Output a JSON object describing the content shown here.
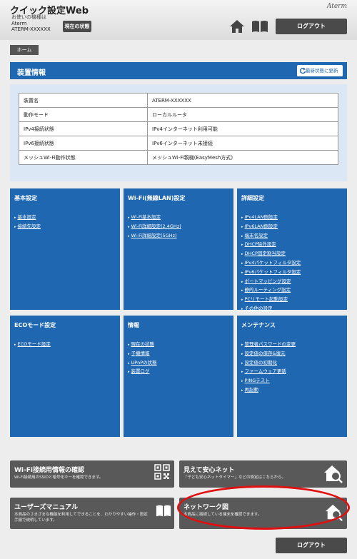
{
  "header": {
    "app_title": "クイック設定Web",
    "device_label": "お使いの機種は",
    "device_name": "Aterm",
    "device_id": "ATERM-XXXXXX",
    "status_button": "現在の状態",
    "brand": "Aterm",
    "logout": "ログアウト"
  },
  "breadcrumb": "ホーム",
  "device_info": {
    "title": "装置情報",
    "refresh": "最新状態に更新",
    "rows": [
      {
        "key": "装置名",
        "value": "ATERM-XXXXXX"
      },
      {
        "key": "動作モード",
        "value": "ローカルルータ"
      },
      {
        "key": "IPv4接続状態",
        "value": "IPv4インターネット利用可能"
      },
      {
        "key": "IPv6接続状態",
        "value": "IPv6インターネット未接続"
      },
      {
        "key": "メッシュWi-Fi動作状態",
        "value": "メッシュWi-Fi親機(EasyMesh方式)"
      }
    ]
  },
  "menus": [
    {
      "title": "基本設定",
      "items": [
        "基本設定",
        "接続先設定"
      ]
    },
    {
      "title": "Wi-Fi(無線LAN)設定",
      "items": [
        "Wi-Fi基本設定",
        "Wi-Fi詳細設定(2.4GHz)",
        "Wi-Fi詳細設定(5GHz)"
      ]
    },
    {
      "title": "詳細設定",
      "items": [
        "IPv4LAN側設定",
        "IPv6LAN側設定",
        "端末名設定",
        "DHCP除外設定",
        "DHCP固定割当設定",
        "IPv4パケットフィルタ設定",
        "IPv6パケットフィルタ設定",
        "ポートマッピング設定",
        "静的ルーティング設定",
        "PCリモート起動設定",
        "その他の設定"
      ]
    },
    {
      "title": "ECOモード設定",
      "items": [
        "ECOモード設定"
      ]
    },
    {
      "title": "情報",
      "items": [
        "現在の状態",
        "子機情報",
        "UPnPの状態",
        "装置ログ"
      ]
    },
    {
      "title": "メンテナンス",
      "items": [
        "管理者パスワードの変更",
        "設定値の保存&復元",
        "設定値の初期化",
        "ファームウェア更新",
        "PINGテスト",
        "再起動"
      ]
    }
  ],
  "quick": [
    {
      "title": "Wi-Fi接続用情報の確認",
      "desc": "Wi-Fi接続用のSSIDと暗号化キーを確認できます。",
      "icon": "qr-code-icon"
    },
    {
      "title": "見えて安心ネット",
      "desc": "「子ども安心ネットタイマー」などの設定はこちらから。",
      "icon": "home-search-icon"
    },
    {
      "title": "ユーザーズマニュアル",
      "desc": "本商品のさまざまな機能を利用してできることを、わかりやすい操作・設定手順で説明しています。",
      "icon": "book-icon"
    },
    {
      "title": "ネットワーク図",
      "desc": "本商品に接続している端末を確認できます。",
      "icon": "home-search-icon"
    }
  ],
  "footer": {
    "logout": "ログアウト"
  },
  "colors": {
    "accent": "#1f67b0",
    "panel": "#dbe7f4",
    "highlight": "#e01010"
  }
}
